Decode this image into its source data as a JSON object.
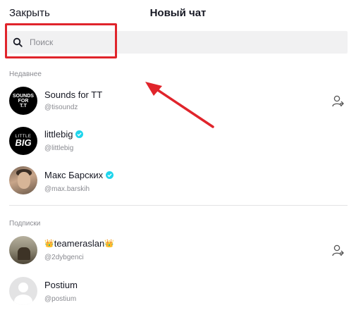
{
  "header": {
    "close_label": "Закрыть",
    "title": "Новый чат"
  },
  "search": {
    "placeholder": "Поиск",
    "icon": "search-icon"
  },
  "colors": {
    "accent_red": "#e0242b",
    "verified_blue": "#20d5ec",
    "secondary_text": "#8a8b91"
  },
  "recent": {
    "label": "Недавнее",
    "items": [
      {
        "name": "Sounds for TT",
        "handle": "@tisoundz",
        "verified": false,
        "avatar_text": [
          "SOUNDS",
          "FOR",
          "T.T"
        ]
      },
      {
        "name": "littlebig",
        "handle": "@littlebig",
        "verified": true,
        "avatar_text": [
          "LITTLE",
          "BIG"
        ]
      },
      {
        "name": "Макс Барских",
        "handle": "@max.barskih",
        "verified": true
      }
    ]
  },
  "following": {
    "label": "Подписки",
    "items": [
      {
        "name": "teameraslan",
        "handle": "@2dybgenci",
        "crown_prefix": "👑",
        "crown_suffix": "👑"
      },
      {
        "name": "Postium",
        "handle": "@postium"
      }
    ]
  }
}
